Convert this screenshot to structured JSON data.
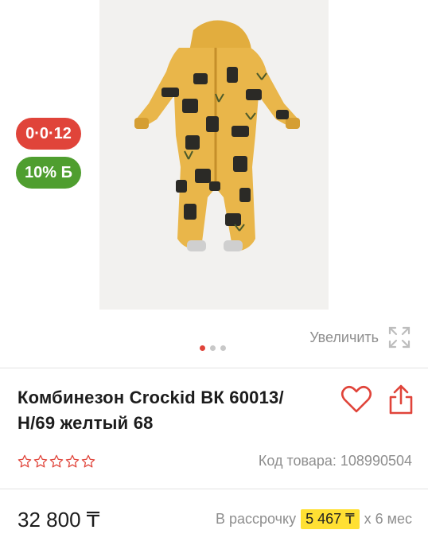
{
  "product": {
    "title": "Комбинезон Crockid ВК 60013/Н/69 желтый 68",
    "sku_label": "Код товара: 108990504",
    "price": "32 800 ₸",
    "rating_stars": 0
  },
  "badges": {
    "installment": "0·0·12",
    "cashback": "10% Б"
  },
  "gallery": {
    "zoom_label": "Увеличить",
    "image_count": 3,
    "active_image": 1
  },
  "credit": {
    "prefix": "В рассрочку",
    "amount": "5 467 ₸",
    "suffix": "x 6 мес"
  },
  "colors": {
    "accent_red": "#e0443a",
    "accent_green": "#4f9e2f",
    "highlight_yellow": "#ffe033",
    "muted_text": "#8e8e8e",
    "garment_yellow": "#e9b64a"
  },
  "icons": [
    "heart-icon",
    "share-icon",
    "expand-icon",
    "star-outline-icon"
  ]
}
